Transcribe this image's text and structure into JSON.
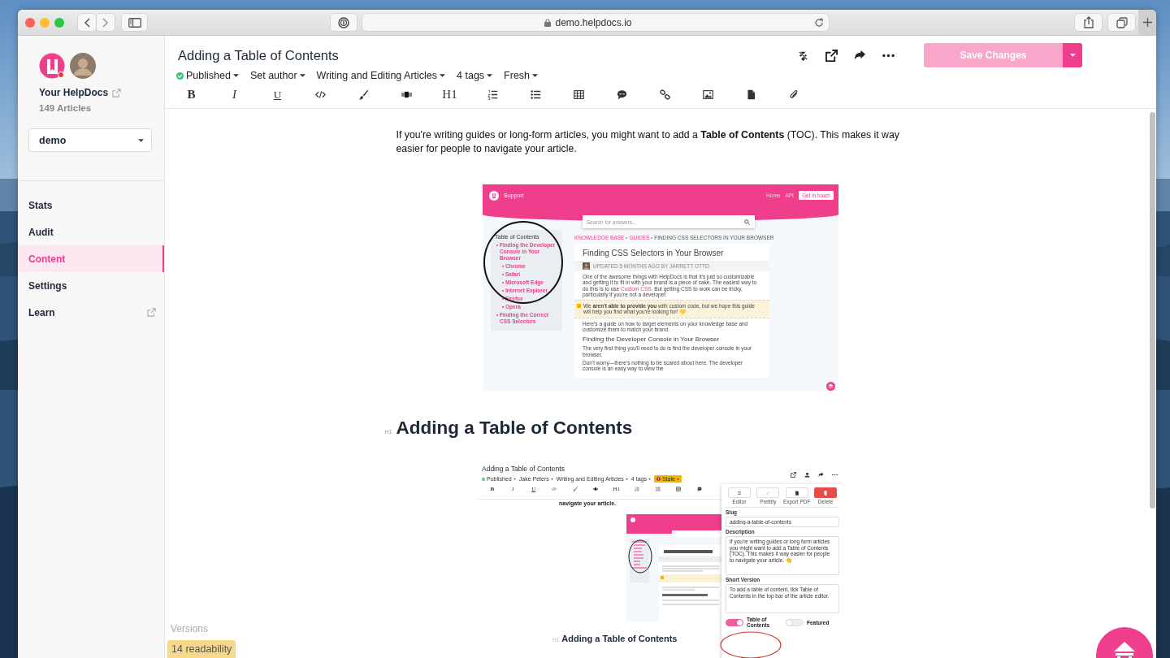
{
  "browser": {
    "url": "demo.helpdocs.io"
  },
  "sidebar": {
    "account": "Your HelpDocs",
    "article_count": "149 Articles",
    "workspace": "demo",
    "items": [
      {
        "label": "Stats",
        "selected": false,
        "external": false
      },
      {
        "label": "Audit",
        "selected": false,
        "external": false
      },
      {
        "label": "Content",
        "selected": true,
        "external": false
      },
      {
        "label": "Settings",
        "selected": false,
        "external": false
      },
      {
        "label": "Learn",
        "selected": false,
        "external": true
      }
    ]
  },
  "header": {
    "title": "Adding a Table of Contents",
    "meta": [
      {
        "kind": "status",
        "label": "Published"
      },
      {
        "kind": "menu",
        "label": "Set author"
      },
      {
        "kind": "menu",
        "label": "Writing and Editing Articles"
      },
      {
        "kind": "menu",
        "label": "4 tags"
      },
      {
        "kind": "menu",
        "label": "Fresh"
      }
    ],
    "save_button": "Save Changes",
    "toolbar": [
      {
        "kind": "text",
        "label": "B"
      },
      {
        "kind": "text",
        "label": "I"
      },
      {
        "kind": "text",
        "label": "U"
      },
      {
        "kind": "icon"
      },
      {
        "kind": "icon"
      },
      {
        "kind": "icon"
      },
      {
        "kind": "text",
        "label": "H1"
      },
      {
        "kind": "icon"
      },
      {
        "kind": "icon"
      },
      {
        "kind": "icon"
      },
      {
        "kind": "icon"
      },
      {
        "kind": "icon"
      },
      {
        "kind": "icon"
      },
      {
        "kind": "icon"
      },
      {
        "kind": "icon"
      }
    ]
  },
  "article": {
    "intro": "If you're writing guides or long-form articles, you might want to add a **Table of Contents** (TOC). This makes it way easier for people to navigate your article.",
    "screenshot_1": {
      "brand": "Support",
      "nav": [
        "Home",
        "API"
      ],
      "cta": "Get in touch",
      "search_placeholder": "Search for answers...",
      "toc_title": "Table of Contents",
      "toc": [
        {
          "label": "Finding the Developer Console in Your Browser",
          "children": [
            {
              "label": "Chrome"
            },
            {
              "label": "Safari"
            },
            {
              "label": "Microsoft Edge"
            },
            {
              "label": "Internet Explorer"
            },
            {
              "label": "Firefox"
            },
            {
              "label": "Opera"
            }
          ]
        },
        {
          "label": "Finding the Correct CSS Selectors"
        }
      ],
      "breadcrumb": [
        "KNOWLEDGE BASE",
        "GUIDES",
        "FINDING CSS SELECTORS IN YOUR BROWSER"
      ],
      "title": "Finding CSS Selectors in Your Browser",
      "byline": "UPDATED 5 MONTHS AGO BY JARRETT OTTO",
      "intro_before": "One of the awesome things with HelpDocs is that it's just so customizable and getting it to fit in with your brand is a piece of cake. The easiest way to do this is to use ",
      "intro_link": "Custom CSS",
      "intro_after": ". But getting CSS to work can be tricky, particularly if you're not a developer.",
      "callout": "We **aren't able to provide you** with custom code, but we hope this guide will help you find what you're looking for! 💛",
      "paragraph": "Here's a guide on how to target elements on your knowledge base and customize them to match your brand.",
      "subheading": "Finding the Developer Console in Your Browser",
      "paragraphs": [
        "The very first thing you'll need to do is find the developer console in your browser.",
        "Don't worry—there's nothing to be scared about here. The developer console is an easy way to view the"
      ]
    },
    "heading_marker": "H1",
    "heading": "Adding a Table of Contents",
    "screenshot_2": {
      "title": "Adding a Table of Contents",
      "meta": [
        {
          "kind": "status",
          "label": "Published"
        },
        {
          "kind": "menu",
          "label": "Jake Peters"
        },
        {
          "kind": "menu",
          "label": "Writing and Editing Articles"
        },
        {
          "kind": "menu",
          "label": "4 tags"
        },
        {
          "kind": "badge",
          "label": "Stale"
        }
      ],
      "toolbar": [
        {
          "kind": "text",
          "label": "B"
        },
        {
          "kind": "text",
          "label": "I"
        },
        {
          "kind": "text",
          "label": "U"
        },
        {
          "kind": "icon"
        },
        {
          "kind": "icon"
        },
        {
          "kind": "icon"
        },
        {
          "kind": "text",
          "label": "H1"
        },
        {
          "kind": "icon"
        },
        {
          "kind": "icon"
        },
        {
          "kind": "icon"
        },
        {
          "kind": "icon"
        }
      ],
      "text": "navigate your article.",
      "heading_marker": "H1",
      "heading": "Adding a Table of Contents",
      "actions": [
        {
          "kind": "default",
          "label": "Editor"
        },
        {
          "kind": "default",
          "label": "Prettify"
        },
        {
          "kind": "default",
          "label": "Export PDF"
        },
        {
          "kind": "danger",
          "label": "Delete"
        }
      ],
      "slug_label": "Slug",
      "slug": "adding-a-table-of-contents",
      "description_label": "Description",
      "description": "If you're writing guides or long form articles you might want to add a Table of Contents (TOC). This makes it way easier for people to navigate your article. 👏",
      "short_label": "Short Version",
      "short_version": "To add a table of content, tick Table of Contents in the top bar of the article editor.",
      "toggles": [
        {
          "label": "Table of Contents",
          "on": true
        },
        {
          "label": "Featured",
          "on": false
        }
      ]
    }
  },
  "versions": "Versions",
  "readability": "14 readability"
}
